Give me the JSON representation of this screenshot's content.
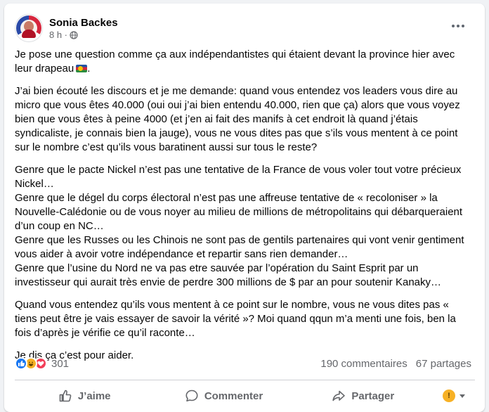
{
  "post": {
    "author": "Sonia Backes",
    "time": "8 h ·",
    "paragraphs": [
      "Je pose une question comme ça aux indépendantistes qui étaient devant la province hier avec leur drapeau",
      "J’ai bien écouté les discours et je me demande: quand vous entendez vos leaders vous dire au micro que vous êtes 40.000 (oui oui j’ai bien entendu 40.000, rien que ça) alors que vous voyez bien que vous êtes à peine 4000 (et j’en ai fait des manifs à cet endroit là quand j’étais syndicaliste, je connais bien la jauge), vous ne vous dites pas que s’ils vous mentent à ce point sur le nombre c’est qu’ils vous baratinent aussi sur tous le reste?",
      "Genre que le pacte Nickel n’est pas une tentative de la France de vous voler tout votre précieux Nickel…\nGenre que le dégel du corps électoral n’est pas une affreuse tentative de « recoloniser » la Nouvelle-Calédonie ou de vous noyer au milieu de millions de métropolitains qui débarqueraient d’un coup en NC…\nGenre que les Russes ou les Chinois ne sont pas de gentils partenaires qui vont venir gentiment vous aider à avoir votre indépendance et repartir sans rien demander…\nGenre que l’usine du Nord ne va pas etre sauvée par l’opération du Saint Esprit par un investisseur qui aurait très envie de perdre 300 millions de $ par an pour soutenir Kanaky…",
      "Quand vous entendez qu’ils vous mentent à ce point sur le nombre, vous ne vous dites pas « tiens peut être je vais essayer de savoir la vérité »? Moi quand qqun m’a menti une fois, ben la fois d’après je vérifie ce qu’il raconte…",
      "Je dis ça c’est pour aider."
    ],
    "flag_icon": "kanaky-flag-emoji"
  },
  "stats": {
    "reaction_count": "301",
    "comments": "190 commentaires",
    "shares": "67 partages",
    "reaction_icons": [
      "like-icon",
      "haha-icon",
      "love-icon"
    ]
  },
  "actions": {
    "like": "J’aime",
    "comment": "Commenter",
    "share": "Partager"
  },
  "colors": {
    "background": "#f0f2f5",
    "card": "#ffffff",
    "secondary_text": "#65676b",
    "like_blue": "#1877f2"
  }
}
